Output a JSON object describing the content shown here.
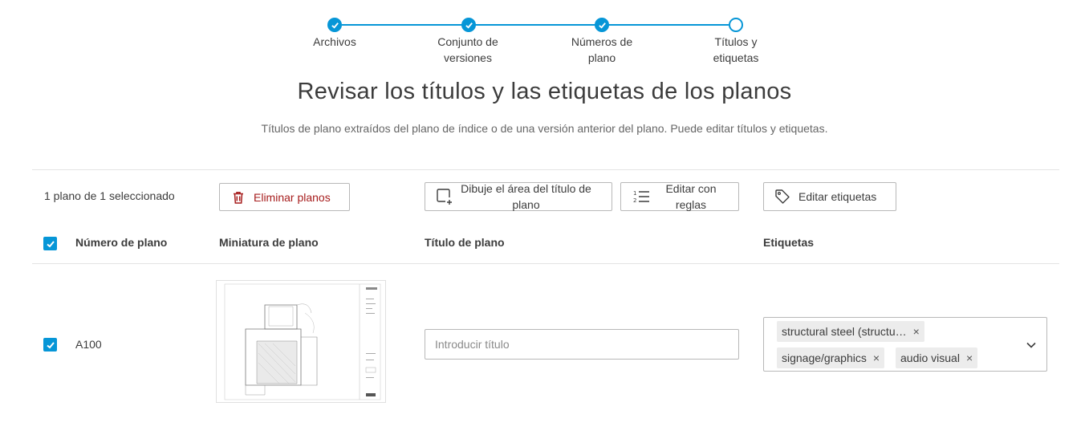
{
  "stepper": {
    "steps": [
      {
        "label": "Archivos",
        "state": "done"
      },
      {
        "label": "Conjunto de versiones",
        "state": "done"
      },
      {
        "label": "Números de plano",
        "state": "done"
      },
      {
        "label": "Títulos y etiquetas",
        "state": "current"
      }
    ]
  },
  "page": {
    "title": "Revisar los títulos y las etiquetas de los planos",
    "subtitle": "Títulos de plano extraídos del plano de índice o de una versión anterior del plano. Puede editar títulos y etiquetas."
  },
  "toolbar": {
    "selection_count": "1 plano de 1 seleccionado",
    "delete_label": "Eliminar planos",
    "draw_title_area_label": "Dibuje el área del título de plano",
    "edit_rules_label": "Editar con reglas",
    "edit_tags_label": "Editar etiquetas"
  },
  "table": {
    "headers": {
      "number": "Número de plano",
      "thumbnail": "Miniatura de plano",
      "title": "Título de plano",
      "tags": "Etiquetas"
    },
    "rows": [
      {
        "checked": true,
        "number": "A100",
        "title_value": "",
        "title_placeholder": "Introducir título",
        "tags": [
          "structural steel (structu…",
          "signage/graphics",
          "audio visual"
        ]
      }
    ]
  },
  "colors": {
    "accent": "#0696d7",
    "danger": "#a61c1c",
    "chip_bg": "#ececec"
  },
  "icons": {
    "step_done": "check-icon",
    "delete": "trash-icon",
    "draw_area": "draw-area-icon",
    "rules": "numbered-list-icon",
    "tags": "tag-icon",
    "dropdown": "chevron-down-icon"
  }
}
